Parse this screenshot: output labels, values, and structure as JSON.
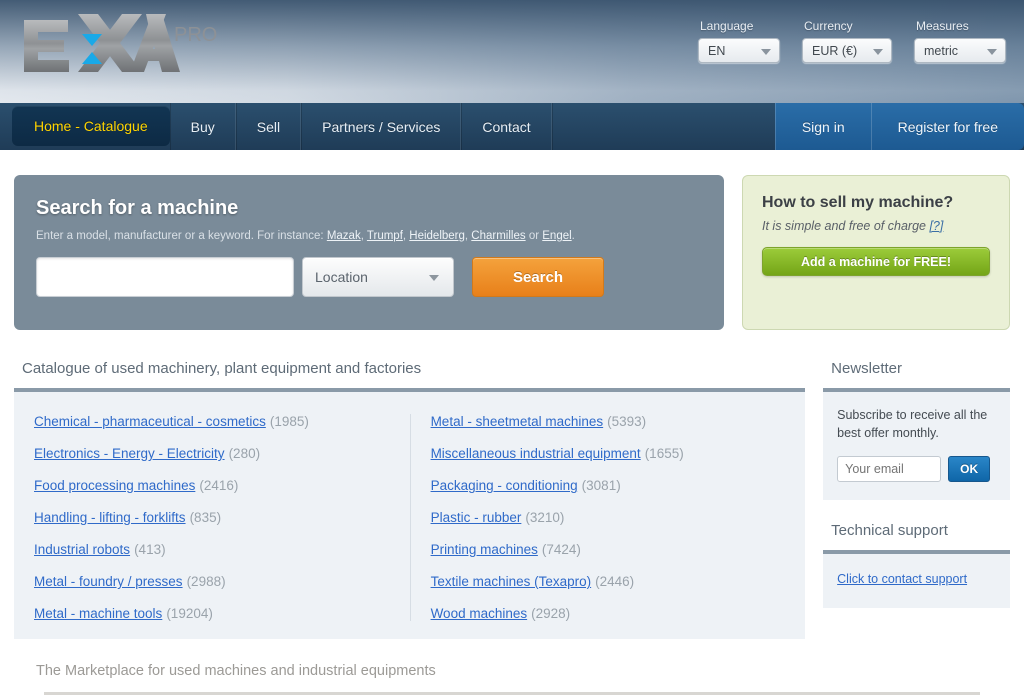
{
  "brand": {
    "name": "EXA",
    "suffix": "PRO"
  },
  "header": {
    "controls": [
      {
        "label": "Language",
        "value": "EN",
        "name": "language-select",
        "width": "w-lang"
      },
      {
        "label": "Currency",
        "value": "EUR (€)",
        "name": "currency-select",
        "width": "w-curr"
      },
      {
        "label": "Measures",
        "value": "metric",
        "name": "measures-select",
        "width": "w-meas"
      }
    ]
  },
  "nav": {
    "items": [
      {
        "label": "Home - Catalogue",
        "active": true
      },
      {
        "label": "Buy",
        "active": false
      },
      {
        "label": "Sell",
        "active": false
      },
      {
        "label": "Partners / Services",
        "active": false
      },
      {
        "label": "Contact",
        "active": false
      }
    ],
    "auth": [
      {
        "label": "Sign in"
      },
      {
        "label": "Register for free"
      }
    ]
  },
  "search": {
    "title": "Search for a machine",
    "hint_prefix": "Enter a model, manufacturer or a keyword. For instance: ",
    "examples": [
      "Mazak",
      "Trumpf",
      "Heidelberg",
      "Charmilles"
    ],
    "hint_or": " or ",
    "last_example": "Engel",
    "hint_end": ".",
    "input_value": "",
    "input_placeholder": "",
    "location_value": "Location",
    "button_label": "Search"
  },
  "sell": {
    "title": "How to sell my machine?",
    "subtitle": "It is simple and free of charge ",
    "help_link": "[?]",
    "button_label": "Add a machine for FREE!"
  },
  "catalogue": {
    "heading": "Catalogue of used machinery, plant equipment and factories",
    "left": [
      {
        "label": "Chemical - pharmaceutical - cosmetics",
        "count": "(1985)"
      },
      {
        "label": "Electronics - Energy - Electricity",
        "count": "(280)"
      },
      {
        "label": "Food processing machines",
        "count": "(2416)"
      },
      {
        "label": "Handling - lifting - forklifts",
        "count": "(835)"
      },
      {
        "label": "Industrial robots",
        "count": "(413)"
      },
      {
        "label": "Metal - foundry / presses",
        "count": "(2988)"
      },
      {
        "label": "Metal - machine tools",
        "count": "(19204)"
      }
    ],
    "right": [
      {
        "label": "Metal - sheetmetal machines",
        "count": "(5393)"
      },
      {
        "label": "Miscellaneous industrial equipment",
        "count": "(1655)"
      },
      {
        "label": "Packaging - conditioning",
        "count": "(3081)"
      },
      {
        "label": "Plastic - rubber",
        "count": "(3210)"
      },
      {
        "label": "Printing machines",
        "count": "(7424)"
      },
      {
        "label": "Textile machines (Texapro)",
        "count": "(2446)"
      },
      {
        "label": "Wood machines",
        "count": "(2928)"
      }
    ]
  },
  "newsletter": {
    "heading": "Newsletter",
    "text": "Subscribe to receive all the best offer monthly.",
    "email_value": "",
    "email_placeholder": "Your email",
    "ok_label": "OK"
  },
  "support": {
    "heading": "Technical support",
    "link_label": "Click to contact support"
  },
  "footer": {
    "title": "The Marketplace for used machines and industrial equipments"
  }
}
